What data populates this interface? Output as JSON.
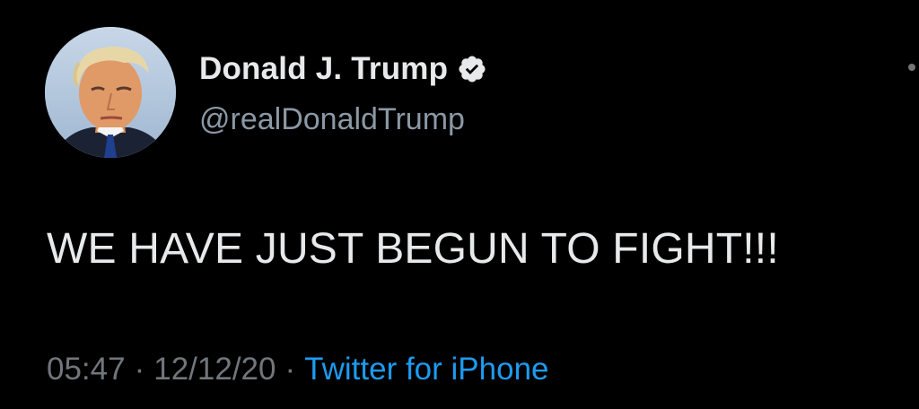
{
  "tweet": {
    "author": {
      "display_name": "Donald J. Trump",
      "handle": "@realDonaldTrump",
      "verified": true,
      "avatar_icon": "profile-photo"
    },
    "text": "WE HAVE JUST BEGUN TO FIGHT!!!",
    "meta": {
      "time": "05:47",
      "separator": "·",
      "date": "12/12/20",
      "source": "Twitter for iPhone"
    },
    "more_icon": "more-options-icon"
  },
  "colors": {
    "background": "#000000",
    "primary_text": "#e7e9ea",
    "secondary_text": "#71767b",
    "link": "#1d9bf0"
  }
}
